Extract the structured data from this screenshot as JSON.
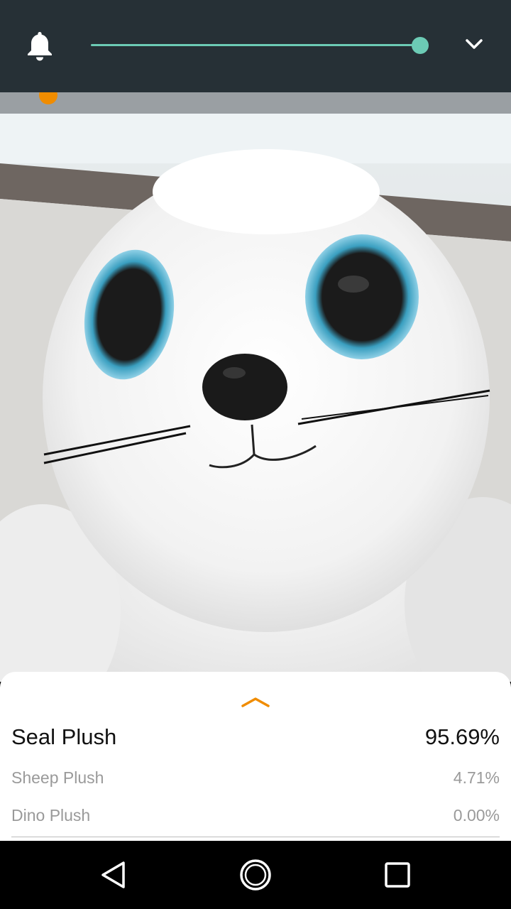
{
  "toolbar": {
    "notification_icon": "bell-icon",
    "collapse_icon": "chevron-down-icon",
    "slider": {
      "value_fraction": 1.0,
      "color": "#6ccbb5"
    },
    "background_color": "#263036"
  },
  "camera": {
    "subject": "white seal plush toy"
  },
  "results": {
    "expand_icon": "chevron-up-icon",
    "accent_color": "#f08c00",
    "items": [
      {
        "label": "Seal Plush",
        "score": "95.69%"
      },
      {
        "label": "Sheep Plush",
        "score": "4.71%"
      },
      {
        "label": "Dino Plush",
        "score": "0.00%"
      }
    ]
  },
  "navbar": {
    "back_icon": "back-triangle-icon",
    "home_icon": "home-circle-icon",
    "recents_icon": "recents-square-icon"
  }
}
